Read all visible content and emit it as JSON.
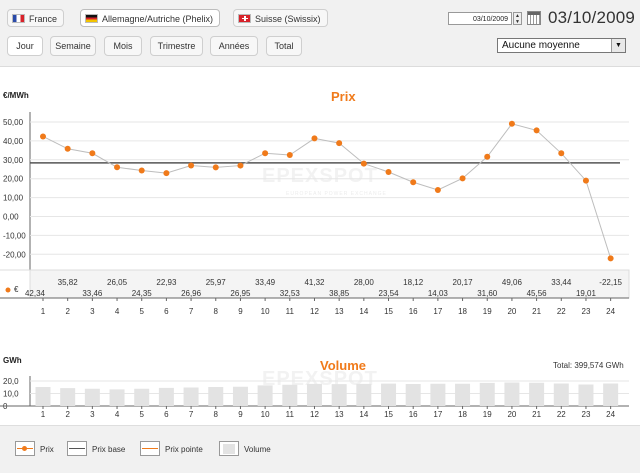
{
  "markets": [
    {
      "label": "France",
      "flag": "flag-france-icon"
    },
    {
      "label": "Allemagne/Autriche (Phelix)",
      "flag": "flag-germany-icon",
      "active": true
    },
    {
      "label": "Suisse (Swissix)",
      "flag": "flag-switzerland-icon"
    }
  ],
  "date": {
    "input_value": "03/10/2009",
    "display": "03/10/2009"
  },
  "periods": [
    "Jour",
    "Semaine",
    "Mois",
    "Trimestre",
    "Années",
    "Total"
  ],
  "average_select": {
    "selected": "Aucune moyenne"
  },
  "colors": {
    "accent": "#f07a1a",
    "price_line": "#bdbdbd",
    "base_line": "#555555",
    "bar": "#e3e3e3"
  },
  "price_chart": {
    "title": "Prix",
    "unit": "€/MWh",
    "legend_symbol": "€"
  },
  "volume_chart": {
    "title": "Volume",
    "unit": "GWh",
    "total_label": "Total: 399,574 GWh"
  },
  "watermark": {
    "main": "EPEXSPOT",
    "sub": "EUROPEAN POWER EXCHANGE"
  },
  "legend": [
    "Prix",
    "Prix base",
    "Prix pointe",
    "Volume"
  ],
  "chart_data": [
    {
      "type": "line",
      "title": "Prix",
      "ylabel": "€/MWh",
      "ylim": [
        -30,
        50
      ],
      "yticks": [
        "50,00",
        "40,00",
        "30,00",
        "20,00",
        "10,00",
        "0,00",
        "-10,00",
        "-20,00"
      ],
      "x": [
        1,
        2,
        3,
        4,
        5,
        6,
        7,
        8,
        9,
        10,
        11,
        12,
        13,
        14,
        15,
        16,
        17,
        18,
        19,
        20,
        21,
        22,
        23,
        24
      ],
      "series": [
        {
          "name": "Prix",
          "values": [
            42.34,
            35.82,
            33.46,
            26.05,
            24.35,
            22.93,
            26.96,
            25.97,
            26.95,
            33.49,
            32.53,
            41.32,
            38.85,
            28.0,
            23.54,
            18.12,
            14.03,
            20.17,
            31.6,
            49.06,
            45.56,
            33.44,
            19.01,
            -22.15
          ]
        },
        {
          "name": "Prix base",
          "values": [
            28.4
          ]
        }
      ],
      "value_labels": [
        "42,34",
        "35,82",
        "33,46",
        "26,05",
        "24,35",
        "22,93",
        "26,96",
        "25,97",
        "26,95",
        "33,49",
        "32,53",
        "41,32",
        "38,85",
        "28,00",
        "23,54",
        "18,12",
        "14,03",
        "20,17",
        "31,60",
        "49,06",
        "45,56",
        "33,44",
        "19,01",
        "-22,15"
      ],
      "grid": true
    },
    {
      "type": "bar",
      "title": "Volume",
      "ylabel": "GWh",
      "ylim": [
        0,
        22
      ],
      "yticks": [
        "20,0",
        "10,0",
        "0"
      ],
      "categories": [
        "1",
        "2",
        "3",
        "4",
        "5",
        "6",
        "7",
        "8",
        "9",
        "10",
        "11",
        "12",
        "13",
        "14",
        "15",
        "16",
        "17",
        "18",
        "19",
        "20",
        "21",
        "22",
        "23",
        "24"
      ],
      "values": [
        15.2,
        14.3,
        13.8,
        13.3,
        13.8,
        14.5,
        14.8,
        15.2,
        15.4,
        16.5,
        17.0,
        17.7,
        17.5,
        17.7,
        17.9,
        17.6,
        17.8,
        17.8,
        18.5,
        18.8,
        18.6,
        18.0,
        17.2,
        18.0
      ],
      "grid": true
    }
  ]
}
